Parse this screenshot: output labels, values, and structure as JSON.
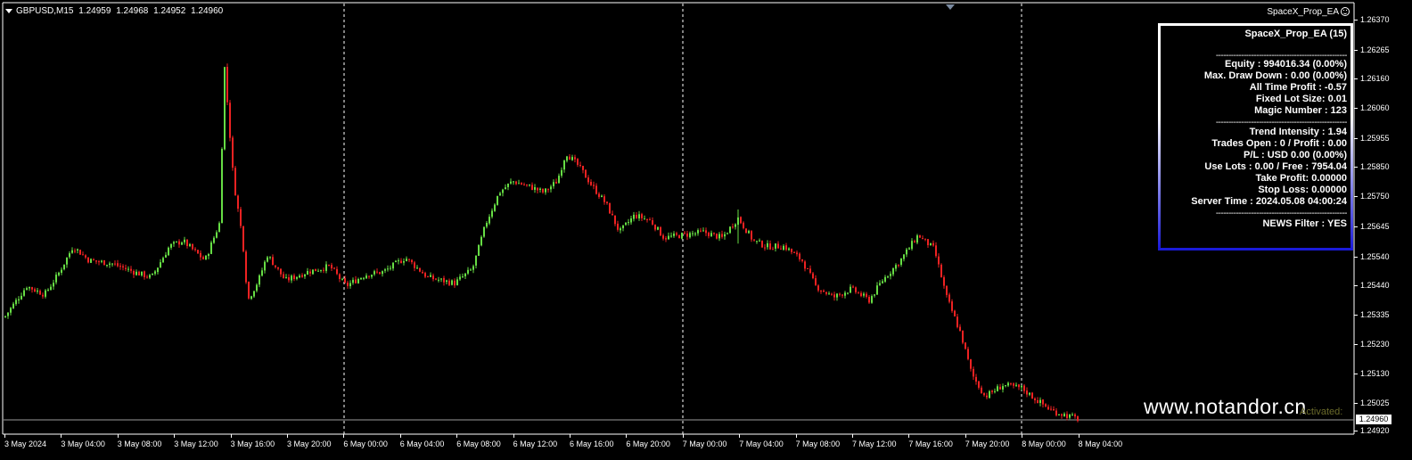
{
  "header": {
    "symbol": "GBPUSD,M15",
    "open": "1.24959",
    "high": "1.24968",
    "low": "1.24952",
    "close": "1.24960"
  },
  "ea_label": "SpaceX_Prop_EA",
  "panel": {
    "title": "SpaceX_Prop_EA (15)",
    "separator": "----------------------------------------------------",
    "lines": [
      "Equity : 994016.34 (0.00%)",
      "Max. Draw Down : 0.00 (0.00%)",
      "All Time Profit : -0.57",
      "Fixed Lot Size: 0.01",
      "Magic Number : 123",
      "Trend Intensity : 1.94",
      "Trades Open : 0 / Profit : 0.00",
      "P/L : USD 0.00 (0.00%)",
      "Use Lots : 0.00 / Free : 7954.04",
      "Take Profit: 0.00000",
      "Stop Loss: 0.00000",
      "Server Time : 2024.05.08 04:00:24",
      "NEWS Filter : YES"
    ]
  },
  "y_axis": {
    "ticks": [
      "1.26370",
      "1.26265",
      "1.26160",
      "1.26060",
      "1.25955",
      "1.25850",
      "1.25750",
      "1.25645",
      "1.25540",
      "1.25440",
      "1.25335",
      "1.25230",
      "1.25130",
      "1.25025",
      "1.24920"
    ],
    "current_price": "1.24960"
  },
  "x_axis": {
    "ticks": [
      "3 May 2024",
      "3 May 04:00",
      "3 May 08:00",
      "3 May 12:00",
      "3 May 16:00",
      "3 May 20:00",
      "6 May 00:00",
      "6 May 04:00",
      "6 May 08:00",
      "6 May 12:00",
      "6 May 16:00",
      "6 May 20:00",
      "7 May 00:00",
      "7 May 04:00",
      "7 May 08:00",
      "7 May 12:00",
      "7 May 16:00",
      "7 May 20:00",
      "8 May 00:00",
      "8 May 04:00"
    ]
  },
  "watermark": "www.notandor.cn",
  "faded_text": "Activated:",
  "colors": {
    "bull": "#66dd44",
    "bear": "#ee2222",
    "background": "#000000",
    "grid_separator": "#ffffff",
    "panel_border_bottom": "#1a1ad8"
  },
  "chart_data": {
    "type": "candlestick",
    "ylim": [
      1.2491,
      1.2638
    ],
    "x": [
      "3 May 2024",
      "3 May 04:00",
      "3 May 08:00",
      "3 May 12:00",
      "3 May 16:00",
      "3 May 20:00",
      "6 May 00:00",
      "6 May 04:00",
      "6 May 08:00",
      "6 May 12:00",
      "6 May 16:00",
      "6 May 20:00",
      "7 May 00:00",
      "7 May 04:00",
      "7 May 08:00",
      "7 May 12:00",
      "7 May 16:00",
      "7 May 20:00",
      "8 May 00:00",
      "8 May 04:00"
    ],
    "close": [
      1.2539,
      1.2556,
      1.2551,
      1.2557,
      1.255,
      1.2549,
      1.2545,
      1.2552,
      1.2547,
      1.2579,
      1.2591,
      1.2568,
      1.2562,
      1.2561,
      1.2545,
      1.2538,
      1.2562,
      1.251,
      1.2505,
      1.2496
    ],
    "current_price": 1.2496
  }
}
